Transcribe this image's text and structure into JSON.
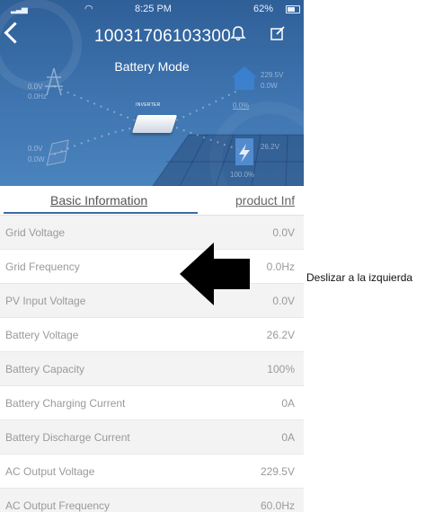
{
  "status_bar": {
    "time": "8:25 PM",
    "battery_percent": "62%",
    "signal_icon": "signal-bars-icon",
    "wifi_icon": "wifi-icon"
  },
  "header": {
    "device_id": "10031706103300",
    "mode": "Battery Mode",
    "back_icon": "back-chevron-icon",
    "bell_icon": "bell-icon",
    "edit_icon": "edit-icon"
  },
  "diagram": {
    "pv_voltage": "0.0V",
    "pv_power": "0.0Hz",
    "grid_voltage": "229.5V",
    "grid_power": "0.0W",
    "grid_percent": "0.0%",
    "inverter_label": "INVERTER",
    "solar_voltage": "0.0V",
    "solar_power": "0.0W",
    "battery_voltage": "26.2V",
    "battery_percent": "100.0%"
  },
  "tabs": [
    {
      "label": "Basic Information"
    },
    {
      "label": "product Inf"
    }
  ],
  "rows": [
    {
      "label": "Grid Voltage",
      "value": "0.0V"
    },
    {
      "label": "Grid Frequency",
      "value": "0.0Hz"
    },
    {
      "label": "PV Input Voltage",
      "value": "0.0V"
    },
    {
      "label": "Battery Voltage",
      "value": "26.2V"
    },
    {
      "label": "Battery Capacity",
      "value": "100%"
    },
    {
      "label": "Battery Charging Current",
      "value": "0A"
    },
    {
      "label": "Battery Discharge Current",
      "value": "0A"
    },
    {
      "label": "AC Output Voltage",
      "value": "229.5V"
    },
    {
      "label": "AC Output Frequency",
      "value": "60.0Hz"
    }
  ],
  "annotation": {
    "hint": "Deslizar a la izquierda",
    "arrow_icon": "left-arrow-icon"
  },
  "colors": {
    "header_blue": "#3f75b0",
    "tab_underline": "#3c6aa3"
  }
}
